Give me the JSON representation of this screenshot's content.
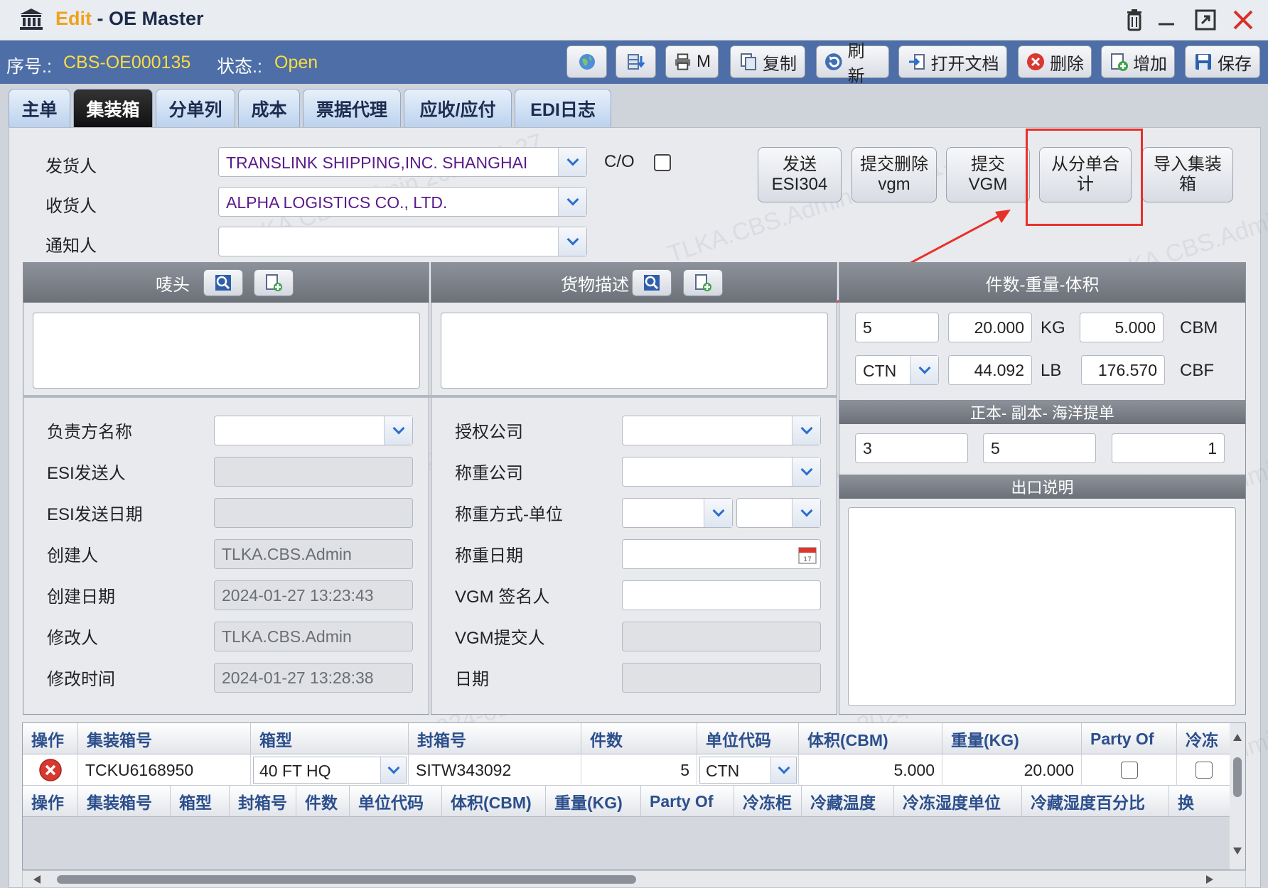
{
  "window": {
    "title_prefix": "Edit",
    "title_sep": " - ",
    "title": "OE Master"
  },
  "infobar": {
    "seq_label": "序号.:",
    "seq_value": "CBS-OE000135",
    "status_label": "状态.:",
    "status_value": "Open"
  },
  "toolbar": {
    "print_label": "M",
    "copy_label": "复制",
    "refresh_label": "刷新",
    "open_doc_label": "打开文档",
    "delete_label": "删除",
    "add_label": "增加",
    "save_label": "保存"
  },
  "tabs": [
    "主单",
    "集装箱",
    "分单列",
    "成本",
    "票据代理",
    "应收/应付",
    "EDI日志"
  ],
  "parties": {
    "shipper_label": "发货人",
    "shipper_value": "TRANSLINK SHIPPING,INC. SHANGHAI",
    "consignee_label": "收货人",
    "consignee_value": "ALPHA LOGISTICS CO., LTD.",
    "notify_label": "通知人",
    "notify_value": "",
    "co_label": "C/O"
  },
  "action_buttons": {
    "send_esi": [
      "发送",
      "ESI304"
    ],
    "submit_delete_vgm": [
      "提交删除",
      "vgm"
    ],
    "submit_vgm": [
      "提交",
      "VGM"
    ],
    "sum_from_hbl": [
      "从分单合",
      "计"
    ],
    "import_container": [
      "导入集装",
      "箱"
    ]
  },
  "marks_panel": {
    "title": "唛头"
  },
  "desc_panel": {
    "title": "货物描述"
  },
  "pkg_panel": {
    "title": "件数-重量-体积",
    "pieces": "5",
    "unit": "CTN",
    "weight_kg": "20.000",
    "kg_label": "KG",
    "weight_lb": "44.092",
    "lb_label": "LB",
    "volume_cbm": "5.000",
    "cbm_label": "CBM",
    "volume_cbf": "176.570",
    "cbf_label": "CBF"
  },
  "bl_panel": {
    "title": "正本- 副本- 海洋提单",
    "original": "3",
    "copy": "5",
    "ocean": "1"
  },
  "export_panel": {
    "title": "出口说明"
  },
  "left_fields": {
    "responsible_label": "负责方名称",
    "esi_sender_label": "ESI发送人",
    "esi_date_label": "ESI发送日期",
    "creator_label": "创建人",
    "creator_value": "TLKA.CBS.Admin",
    "created_label": "创建日期",
    "created_value": "2024-01-27 13:23:43",
    "modifier_label": "修改人",
    "modifier_value": "TLKA.CBS.Admin",
    "modified_label": "修改时间",
    "modified_value": "2024-01-27 13:28:38"
  },
  "mid_fields": {
    "auth_company_label": "授权公司",
    "weigh_company_label": "称重公司",
    "weigh_method_label": "称重方式-单位",
    "weigh_date_label": "称重日期",
    "vgm_signer_label": "VGM 签名人",
    "vgm_submitter_label": "VGM提交人",
    "date_label": "日期"
  },
  "grid": {
    "headers": [
      "操作",
      "集装箱号",
      "箱型",
      "封箱号",
      "件数",
      "单位代码",
      "体积(CBM)",
      "重量(KG)",
      "Party Of",
      "冷冻"
    ],
    "row": {
      "container_no": "TCKU6168950",
      "type": "40 FT HQ",
      "seal_no": "SITW343092",
      "pieces": "5",
      "unit": "CTN",
      "cbm": "5.000",
      "kg": "20.000"
    },
    "headers2": [
      "操作",
      "集装箱号",
      "箱型",
      "封箱号",
      "件数",
      "单位代码",
      "体积(CBM)",
      "重量(KG)",
      "Party Of",
      "冷冻柜",
      "冷藏温度",
      "冷冻湿度单位",
      "冷藏湿度百分比",
      "换"
    ]
  },
  "watermark": "TLKA.CBS.Admin 2024-01-27",
  "colors": {
    "info_bar": "#4d6ea6",
    "accent_yellow": "#ffdc44",
    "edit_orange": "#f0a21a",
    "highlight_red": "#e8302a"
  }
}
